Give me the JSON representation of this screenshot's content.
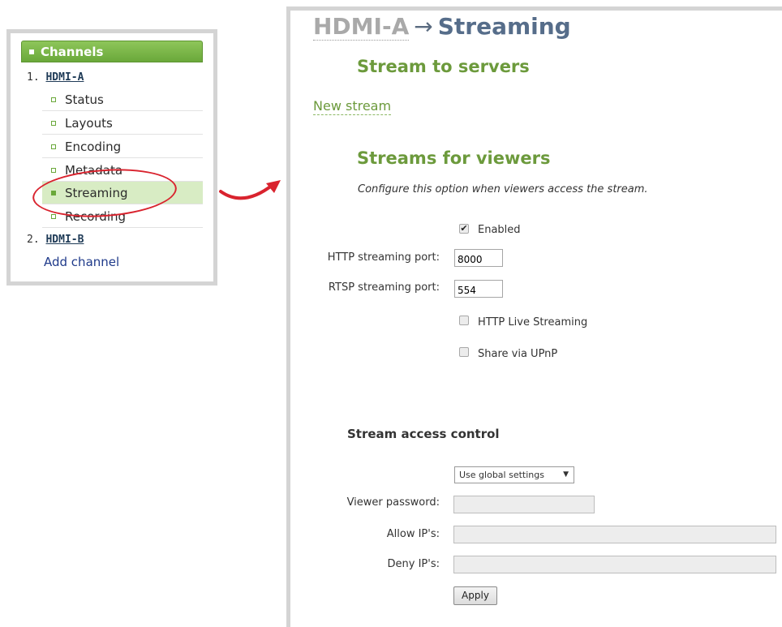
{
  "sidebar": {
    "header": "Channels",
    "channels": [
      {
        "number": "1.",
        "name": "HDMI-A"
      },
      {
        "number": "2.",
        "name": "HDMI-B"
      }
    ],
    "items": [
      {
        "label": "Status"
      },
      {
        "label": "Layouts"
      },
      {
        "label": "Encoding"
      },
      {
        "label": "Metadata"
      },
      {
        "label": "Streaming",
        "active": true
      },
      {
        "label": "Recording"
      }
    ],
    "add_channel": "Add channel"
  },
  "title": {
    "channel": "HDMI-A",
    "separator": "→",
    "page": "Streaming"
  },
  "stream_to_servers": {
    "heading": "Stream to servers",
    "new_stream_link": "New stream"
  },
  "viewers": {
    "heading": "Streams for viewers",
    "hint": "Configure this option when viewers access the stream.",
    "enabled_label": "Enabled",
    "enabled_checked": true,
    "http_port_label": "HTTP streaming port:",
    "http_port_value": "8000",
    "rtsp_port_label": "RTSP streaming port:",
    "rtsp_port_value": "554",
    "hls_label": "HTTP Live Streaming",
    "hls_checked": false,
    "upnp_label": "Share via UPnP",
    "upnp_checked": false
  },
  "access_control": {
    "heading": "Stream access control",
    "mode_selected": "Use global settings",
    "viewer_password_label": "Viewer password:",
    "allow_ips_label": "Allow IP's:",
    "deny_ips_label": "Deny IP's:",
    "apply_label": "Apply"
  },
  "colors": {
    "accent_green": "#6c9a3c",
    "title_blue": "#566d8a",
    "highlight_red": "#d9232e"
  }
}
